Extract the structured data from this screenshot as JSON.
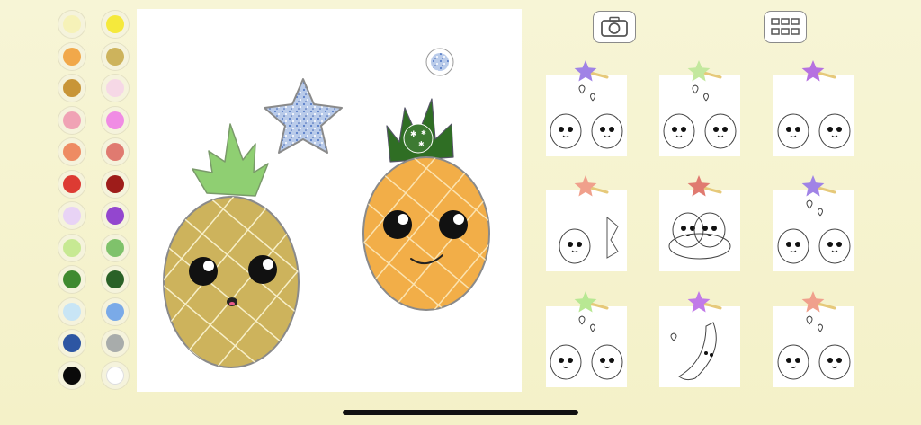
{
  "palette": {
    "colors": [
      "#f6f2b8",
      "#f5e93c",
      "#f1a84a",
      "#cdb35c",
      "#c89538",
      "#f6d8e6",
      "#f0a3b5",
      "#f08ce4",
      "#ee8b63",
      "#e07a70",
      "#dd3b33",
      "#9e1c1a",
      "#e8d3f5",
      "#9346cf",
      "#c7e993",
      "#7fc26b",
      "#3f8a30",
      "#2a6127",
      "#c8e5f5",
      "#7aaae8",
      "#2d56a3",
      "#a8acab",
      "#0a0a0a",
      "#ffffff"
    ]
  },
  "toolbar": {
    "camera_icon": "camera-icon",
    "gallery_icon": "grid-icon"
  },
  "canvas": {
    "stickers": [
      "glitter-star",
      "pineapple-left",
      "pineapple-right",
      "glitter-brush-cursor"
    ]
  },
  "pages": [
    {
      "id": "pineapples-hearts",
      "star_color": "#a083e6"
    },
    {
      "id": "pineapples-hearts-2",
      "star_color": "#c3e89e"
    },
    {
      "id": "strawberries-stars",
      "star_color": "#b671e0"
    },
    {
      "id": "strawberry-leaves",
      "star_color": "#f0a08c"
    },
    {
      "id": "banana-peanuts",
      "star_color": "#e07a70"
    },
    {
      "id": "apples-hearts",
      "star_color": "#a083e6"
    },
    {
      "id": "pears-hearts",
      "star_color": "#b8e893"
    },
    {
      "id": "banana-heart",
      "star_color": "#c17ae8"
    },
    {
      "id": "apples-hearts-2",
      "star_color": "#f0a08c"
    }
  ]
}
